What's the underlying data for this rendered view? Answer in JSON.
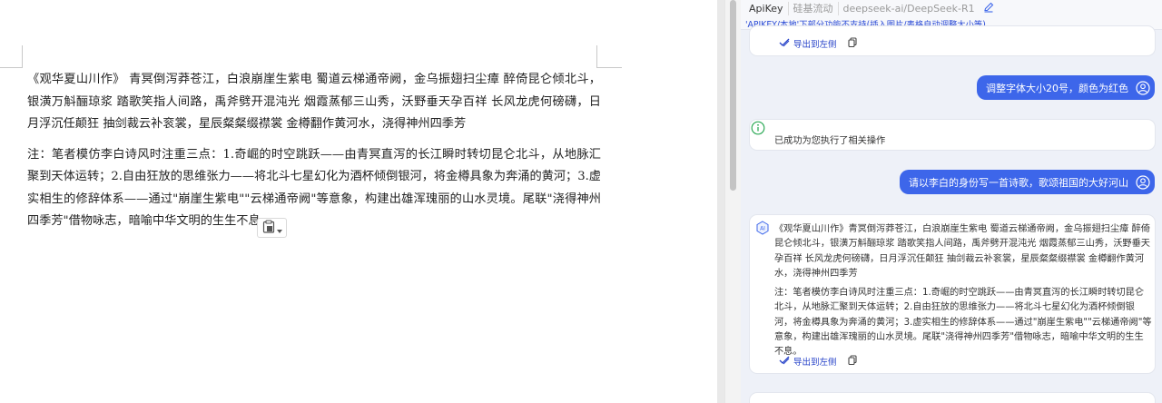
{
  "document": {
    "paragraph1": "《观华夏山川作》 青冥倒泻莽苍江，白浪崩崖生紫电 蜀道云梯通帝阙，金乌振翅扫尘瘴 醉倚昆仑倾北斗，银潢万斛酾琼浆 踏歌笑指人间路，禹斧劈开混沌光 烟霞蒸郁三山秀，沃野垂天孕百祥 长风龙虎何磅礴，日月浮沉任颠狂 抽剑裁云补衮裳，星辰粲粲缀襟裳 金樽翻作黄河水，浇得神州四季芳",
    "paragraph2": "注：笔者模仿李白诗风时注重三点：1.奇崛的时空跳跃——由青冥直泻的长江瞬时转切昆仑北斗，从地脉汇聚到天体运转；2.自由狂放的思维张力——将北斗七星幻化为酒杯倾倒银河，将金樽具象为奔涌的黄河；3.虚实相生的修辞体系——通过\"崩崖生紫电\"\"云梯通帝阙\"等意象，构建出雄浑瑰丽的山水灵境。尾联\"浇得神州四季芳\"借物咏志，暗喻中华文明的生生不息。",
    "paste_icon": "clipboard-icon"
  },
  "panel": {
    "tabs": [
      {
        "label": "ApiKey"
      },
      {
        "label": "硅基流动"
      },
      {
        "label": "deepseek-ai/DeepSeek-R1"
      }
    ],
    "notice": "'APIKEY/本地'下部分功能不支持(插入图片/表格自动调整大小等)",
    "first_card": {
      "export_label": "导出到左侧",
      "copy_icon": "copy-icon"
    },
    "user_message_1": "调整字体大小20号，颜色为红色",
    "system_message": "已成功为您执行了相关操作",
    "user_message_2": "请以李白的身份写一首诗歌，歌颂祖国的大好河山",
    "assistant": {
      "paragraph1": "《观华夏山川作》青冥倒泻莽苍江，白浪崩崖生紫电 蜀道云梯通帝阙，金乌振翅扫尘瘴 醉倚昆仑倾北斗，银潢万斛酾琼浆 踏歌笑指人间路，禹斧劈开混沌光 烟霞蒸郁三山秀，沃野垂天孕百祥 长风龙虎何磅礴，日月浮沉任颠狂 抽剑裁云补衮裳，星辰粲粲缀襟裳 金樽翻作黄河水，浇得神州四季芳",
      "paragraph2": "注：笔者模仿李白诗风时注重三点：1.奇崛的时空跳跃——由青冥直泻的长江瞬时转切昆仑北斗，从地脉汇聚到天体运转；2.自由狂放的思维张力——将北斗七星幻化为酒杯倾倒银河，将金樽具象为奔涌的黄河；3.虚实相生的修辞体系——通过\"崩崖生紫电\"\"云梯通帝阙\"等意象，构建出雄浑瑰丽的山水灵境。尾联\"浇得神州四季芳\"借物咏志，暗喻中华文明的生生不息。",
      "export_label": "导出到左侧"
    },
    "colors": {
      "accent": "#3d66ea",
      "link": "#2440c8",
      "info_green": "#2eaa57"
    }
  }
}
